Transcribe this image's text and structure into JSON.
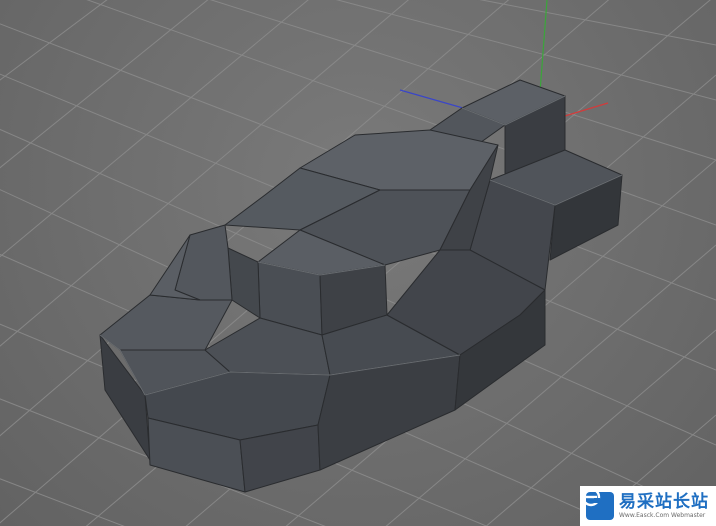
{
  "viewport": {
    "background_color": "#6e6e6e",
    "grid_color": "#8a8a8a",
    "axis_colors": {
      "x": "#d23b3b",
      "y": "#3aa63a",
      "z": "#3a46c8"
    }
  },
  "model": {
    "face_color": "#4a4d52",
    "edge_color": "#2a2c2f",
    "highlight_edge_color": "#6f7378"
  },
  "watermark": {
    "brand": "易采站长站",
    "site": "Www.Easck.Com  Webmaster",
    "logo_icon": "e-logo-icon",
    "logo_color": "#1f6fc2"
  }
}
